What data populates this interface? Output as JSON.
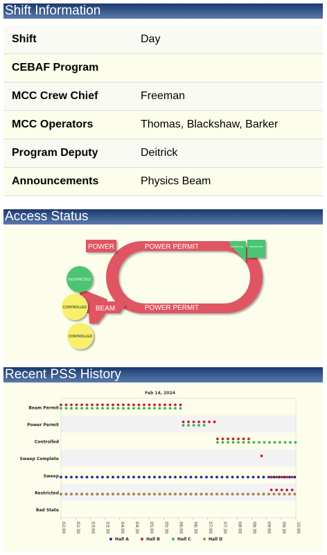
{
  "shift_info": {
    "title": "Shift Information",
    "rows": [
      {
        "label": "Shift",
        "value": "Day"
      },
      {
        "label": "CEBAF Program",
        "value": ""
      },
      {
        "label": "MCC Crew Chief",
        "value": "Freeman"
      },
      {
        "label": "MCC Operators",
        "value": "Thomas, Blackshaw, Barker"
      },
      {
        "label": "Program Deputy",
        "value": "Deitrick"
      },
      {
        "label": "Announcements",
        "value": "Physics Beam"
      }
    ]
  },
  "access_status": {
    "title": "Access Status",
    "power_label": "POWER",
    "power_permit_top": "POWER PERMIT",
    "power_permit_bottom": "POWER PERMIT",
    "beam_label": "BEAM",
    "flag1": "RESTRICTED",
    "flag2": "RESTRICTED",
    "circle_restricted": "RESTRICTED",
    "circle_controlled_1": "CONTROLLED",
    "circle_controlled_2": "CONTROLLED",
    "colors": {
      "red": "#e05562",
      "green": "#4cc473",
      "yellow": "#f6f06c"
    }
  },
  "pss_history": {
    "title": "Recent PSS History",
    "chart_data": {
      "type": "scatter",
      "title": "Feb 14, 2024",
      "categories_y": [
        "Beam Permit",
        "Power Permit",
        "Controlled",
        "Sweep Complete",
        "Sweep",
        "Restricted",
        "Bad State"
      ],
      "x_ticks": [
        "02:00",
        "02:30",
        "03:00",
        "03:30",
        "04:00",
        "04:30",
        "05:00",
        "05:30",
        "06:00",
        "06:30",
        "07:00",
        "07:30",
        "08:00",
        "08:30",
        "09:00",
        "09:30",
        "10:00"
      ],
      "x_range": [
        "02:00",
        "10:00"
      ],
      "grid": true,
      "legend_position": "bottom",
      "series": [
        {
          "name": "Hall A",
          "color": "#1f2aa8",
          "points": [
            {
              "state": "Sweep",
              "from": "02:00",
              "to": "10:00"
            },
            {
              "state": "Restricted",
              "from": "02:00",
              "to": "10:00"
            }
          ]
        },
        {
          "name": "Hall B",
          "color": "#c4202b",
          "points": [
            {
              "state": "Beam Permit",
              "from": "02:00",
              "to": "06:10"
            },
            {
              "state": "Power Permit",
              "from": "06:10",
              "to": "07:20"
            },
            {
              "state": "Controlled",
              "from": "07:20",
              "to": "08:30"
            },
            {
              "state": "Sweep Complete",
              "from": "08:50",
              "to": "08:50"
            },
            {
              "state": "Sweep",
              "from": "09:10",
              "to": "10:00"
            },
            {
              "state": "Restricted",
              "from": "09:10",
              "to": "10:00"
            }
          ]
        },
        {
          "name": "Hall C",
          "color": "#3cb34a",
          "points": [
            {
              "state": "Beam Permit",
              "from": "02:00",
              "to": "06:10"
            },
            {
              "state": "Power Permit",
              "from": "06:10",
              "to": "07:00"
            },
            {
              "state": "Controlled",
              "from": "07:20",
              "to": "10:00"
            }
          ]
        },
        {
          "name": "Hall D",
          "color": "#b8863c",
          "points": [
            {
              "state": "Restricted",
              "from": "02:00",
              "to": "10:00"
            }
          ]
        }
      ]
    }
  }
}
